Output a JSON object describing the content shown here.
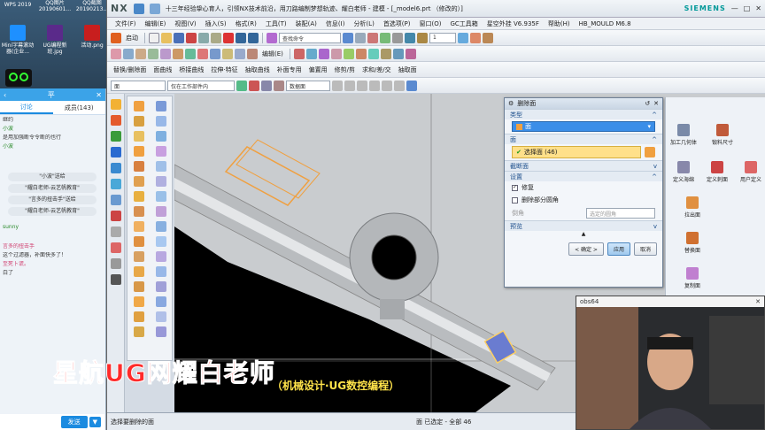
{
  "desktop": {
    "icons": [
      {
        "label": "WPS 2019"
      },
      {
        "label": "QQ图片 20190601..."
      },
      {
        "label": "QQ截图 20190213..."
      },
      {
        "label": "Mini字幕滚动器(企业..."
      },
      {
        "label": "UG编程新班.jpg"
      },
      {
        "label": "活动.png"
      }
    ]
  },
  "chat": {
    "title_pin": "平",
    "tabs": [
      "讨论",
      "成员(143)"
    ],
    "messages": [
      {
        "kind": "text",
        "text": "继约"
      },
      {
        "kind": "name",
        "text": "小波"
      },
      {
        "kind": "text",
        "text": "是用加强断令令断的也行"
      },
      {
        "kind": "name",
        "text": "小波"
      },
      {
        "kind": "notice",
        "text": "\"小波\"送给"
      },
      {
        "kind": "notice",
        "text": "\"耀白老师-云艺帆教育\""
      },
      {
        "kind": "notice",
        "text": "\"言多的扭击手\"送给"
      },
      {
        "kind": "notice",
        "text": "\"耀白老师-云艺帆教育\""
      },
      {
        "kind": "name",
        "text": "sunny"
      },
      {
        "kind": "namepink",
        "text": "言多的扭击手"
      },
      {
        "kind": "text",
        "text": "这个过滤器，补面快多了！"
      },
      {
        "kind": "namepink",
        "text": "至死卜谎。"
      },
      {
        "kind": "text",
        "text": "白了"
      }
    ],
    "send_label": "发送",
    "send_menu": "▼"
  },
  "nx": {
    "logo": "NX",
    "title": "十三年经验挚心育人，引领NX技术前沿，用刀路编制梦想轨迹、耀白老师 - 建模 - [_model6.prt （修改的）]",
    "brand": "SIEMENS",
    "window_buttons": [
      "—",
      "□",
      "✕"
    ],
    "menu": [
      "文件(F)",
      "编辑(E)",
      "视图(V)",
      "插入(S)",
      "格式(R)",
      "工具(T)",
      "装配(A)",
      "信息(I)",
      "分析(L)",
      "首选项(P)",
      "窗口(O)",
      "GC工具箱",
      "星空外挂 V6.935F",
      "帮助(H)",
      "HB_MOULD M6.8"
    ],
    "toolbar1": {
      "start_label": "启动",
      "find_command_placeholder": "查找命令",
      "layer_value": "1"
    },
    "toolbar2": {
      "edit_label": "编辑(E)"
    },
    "toolbar3": {
      "items": [
        "替换/删除面",
        "面曲线",
        "桥接曲线",
        "拉伸·特征",
        "抽取曲线",
        "补面专用",
        "偏置用",
        "修剪/剪",
        "求和/差/交",
        "抽取面"
      ]
    },
    "selection_bar": {
      "filter_value": "面",
      "scope_value": "仅在工作部件内",
      "face_rule_value": "数据面"
    },
    "status": {
      "prompt": "选择要删除的面",
      "selection": "面 已选定 - 全部 46"
    }
  },
  "dialog": {
    "title": "删除面",
    "type_section": "类型",
    "type_value": "面",
    "face_section": "面",
    "select_face_label": "选择面 (46)",
    "section_cut_face": "截断面",
    "settings_section": "设置",
    "repair_label": "修复",
    "delete_partial_round_label": "删除部分圆角",
    "radius_label": "倒角",
    "radius_value": "选定的圆角",
    "preview_section": "预览",
    "ok_label": "< 确定 >",
    "apply_label": "应用",
    "cancel_label": "取消"
  },
  "right_panel": {
    "items": [
      "加工几何体",
      "锻料尺寸",
      "定义海绵",
      "定义刺面",
      "用户定义",
      "拉出面",
      "替换面",
      "复制面"
    ]
  },
  "graphics_overlay": {
    "subtitle": "（机械设计·UG数控编程）"
  },
  "cam": {
    "title": "obs64"
  },
  "watermark": {
    "text": "星航UG网耀白老师"
  },
  "colors": {
    "nx_bg": "#d4dbe4",
    "accent_blue": "#1b8be0",
    "selection_yellow": "#ffe08a",
    "watermark_red": "#ff2a2a"
  }
}
